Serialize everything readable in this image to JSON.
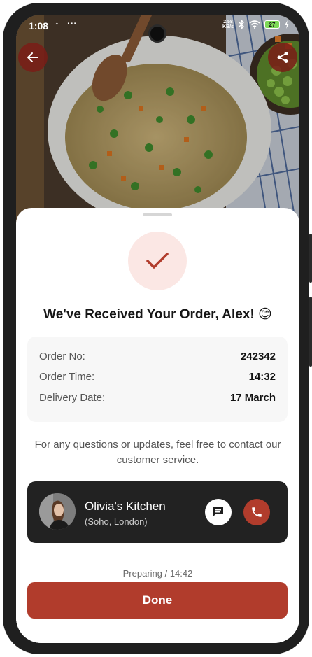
{
  "status_bar": {
    "time": "1:08",
    "upload_indicator": "↑",
    "more_dots": "···",
    "net_speed_value": "2.58",
    "net_speed_unit": "KB/s",
    "battery": "27",
    "icons": [
      "upload-icon",
      "bluetooth-icon",
      "wifi-icon",
      "battery-icon",
      "charging-icon"
    ]
  },
  "header": {
    "back_icon": "arrow-left-icon",
    "share_icon": "share-icon",
    "accent": "#7a1c16"
  },
  "confirmation": {
    "title": "We've Received Your Order, Alex! 😊",
    "check_icon": "checkmark-icon"
  },
  "order": {
    "rows": [
      {
        "label": "Order No:",
        "value": "242342"
      },
      {
        "label": "Order Time:",
        "value": "14:32"
      },
      {
        "label": "Delivery Date:",
        "value": "17 March"
      }
    ]
  },
  "note": "For any questions or updates, feel free to contact our customer service.",
  "kitchen": {
    "name": "Olivia's Kitchen",
    "location": "(Soho, London)",
    "chat_icon": "chat-icon",
    "call_icon": "phone-icon"
  },
  "order_status": "Preparing / 14:42",
  "actions": {
    "done_label": "Done"
  },
  "colors": {
    "primary": "#b13c2c",
    "check_bg": "#fbe7e4",
    "card_bg": "#f7f7f7",
    "dark_card": "#222222"
  }
}
